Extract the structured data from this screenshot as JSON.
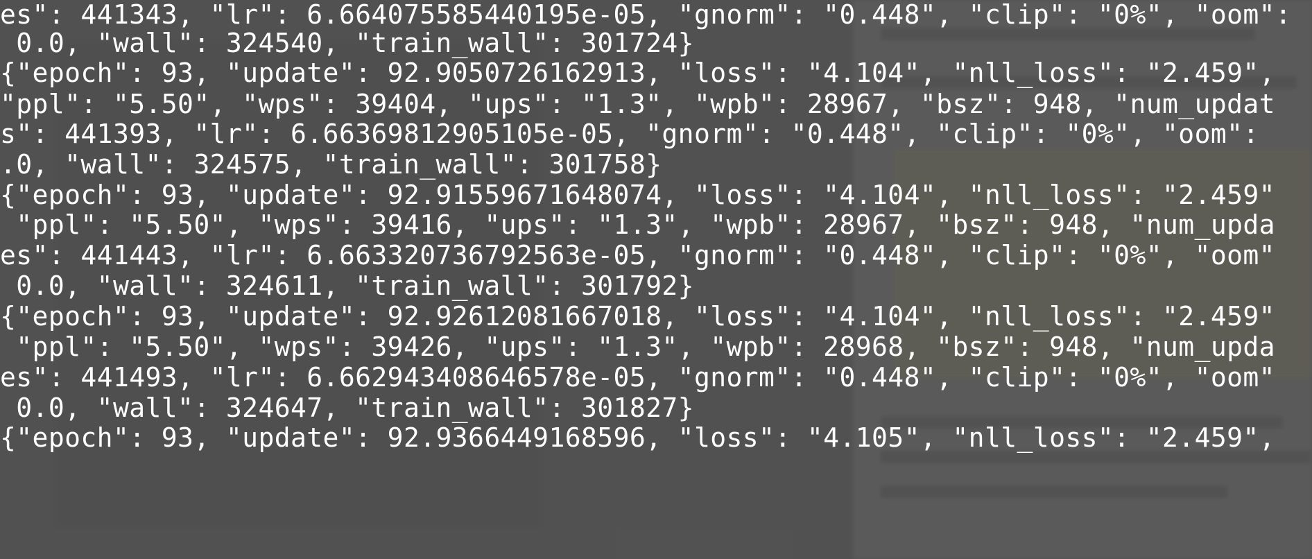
{
  "terminal": {
    "lines": [
      "es\": 441343, \"lr\": 6.664075585440195e-05, \"gnorm\": \"0.448\", \"clip\": \"0%\", \"oom\":",
      " 0.0, \"wall\": 324540, \"train_wall\": 301724}",
      "{\"epoch\": 93, \"update\": 92.9050726162913, \"loss\": \"4.104\", \"nll_loss\": \"2.459\",",
      "\"ppl\": \"5.50\", \"wps\": 39404, \"ups\": \"1.3\", \"wpb\": 28967, \"bsz\": 948, \"num_updat",
      "s\": 441393, \"lr\": 6.66369812905105e-05, \"gnorm\": \"0.448\", \"clip\": \"0%\", \"oom\":",
      ".0, \"wall\": 324575, \"train_wall\": 301758}",
      "{\"epoch\": 93, \"update\": 92.91559671648074, \"loss\": \"4.104\", \"nll_loss\": \"2.459\"",
      " \"ppl\": \"5.50\", \"wps\": 39416, \"ups\": \"1.3\", \"wpb\": 28967, \"bsz\": 948, \"num_upda",
      "es\": 441443, \"lr\": 6.663320736792563e-05, \"gnorm\": \"0.448\", \"clip\": \"0%\", \"oom\"",
      " 0.0, \"wall\": 324611, \"train_wall\": 301792}",
      "{\"epoch\": 93, \"update\": 92.92612081667018, \"loss\": \"4.104\", \"nll_loss\": \"2.459\"",
      " \"ppl\": \"5.50\", \"wps\": 39426, \"ups\": \"1.3\", \"wpb\": 28968, \"bsz\": 948, \"num_upda",
      "es\": 441493, \"lr\": 6.662943408646578e-05, \"gnorm\": \"0.448\", \"clip\": \"0%\", \"oom\"",
      " 0.0, \"wall\": 324647, \"train_wall\": 301827}",
      "{\"epoch\": 93, \"update\": 92.9366449168596, \"loss\": \"4.105\", \"nll_loss\": \"2.459\","
    ]
  }
}
